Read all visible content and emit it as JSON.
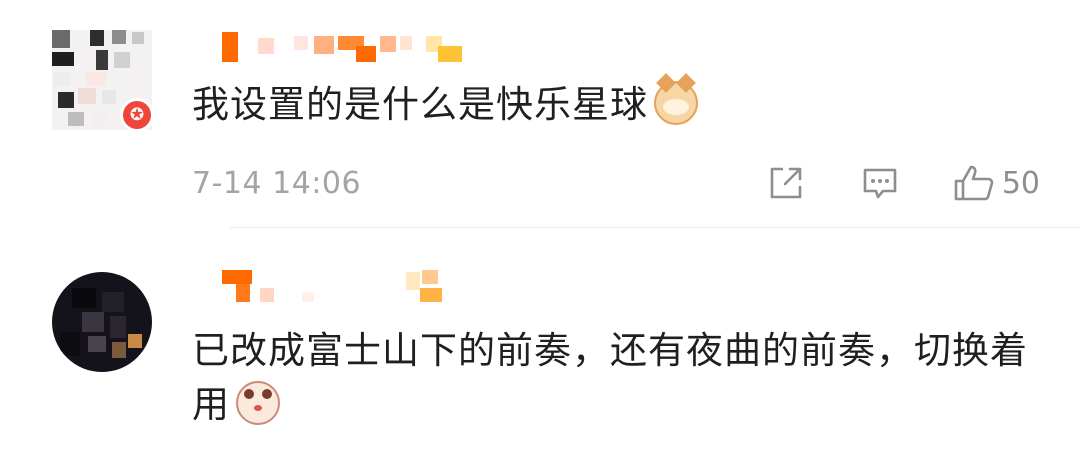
{
  "comments": [
    {
      "text": "我设置的是什么是快乐星球",
      "emoji": "cat-emoji",
      "timestamp": "7-14 14:06",
      "like_count": "50",
      "badge_icon": "star-badge-icon"
    },
    {
      "text": "已改成富士山下的前奏，还有夜曲的前奏，切换着用",
      "emoji": "cow-emoji"
    }
  ],
  "colors": {
    "username_orange": "#ff6a00",
    "badge_red": "#f0453a",
    "text": "#1f1f1f",
    "meta_gray": "#a4a4a4"
  }
}
